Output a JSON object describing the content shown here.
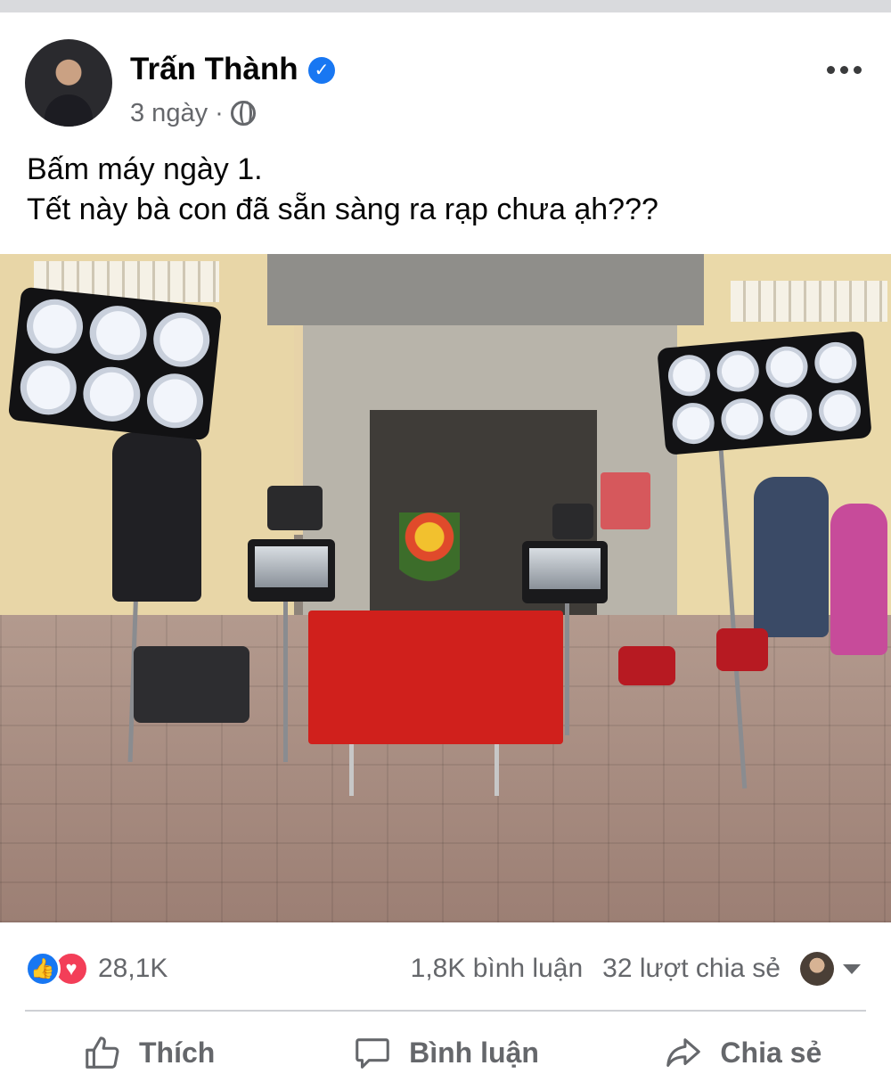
{
  "post": {
    "author": "Trấn Thành",
    "time": "3 ngày",
    "separator": "·",
    "text_line1": "Bấm máy ngày 1.",
    "text_line2": "Tết này bà con đã sẵn sàng ra rạp chưa ạh???"
  },
  "icons": {
    "verified": "verified-badge-icon",
    "privacy": "globe-icon",
    "more": "more-options-icon",
    "like_reaction": "like-reaction-icon",
    "love_reaction": "love-reaction-icon",
    "like": "thumbs-up-icon",
    "comment": "speech-bubble-icon",
    "share": "share-arrow-icon",
    "dropdown": "caret-down-icon"
  },
  "stats": {
    "reactions_count": "28,1K",
    "comments": "1,8K bình luận",
    "shares": "32 lượt chia sẻ"
  },
  "actions": {
    "like": "Thích",
    "comment": "Bình luận",
    "share": "Chia sẻ"
  },
  "colors": {
    "brand_blue": "#1877f2",
    "love_red": "#f33e58",
    "secondary_text": "#65676b"
  }
}
